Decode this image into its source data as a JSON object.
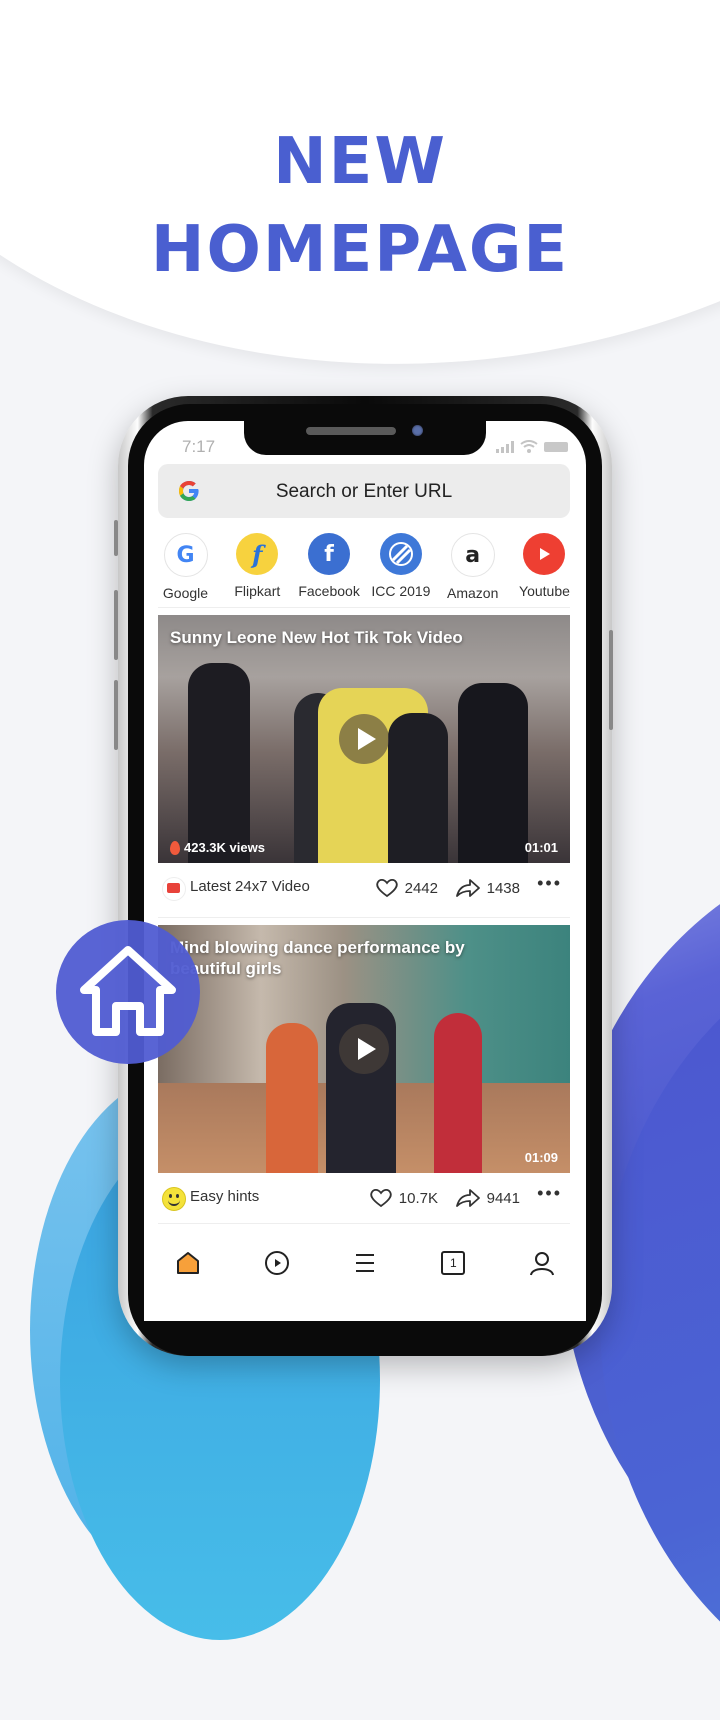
{
  "headline": {
    "line1": "NEW",
    "line2": "HOMEPAGE",
    "color": "#4a5fd0"
  },
  "status_bar": {
    "time": "7:17"
  },
  "search": {
    "placeholder": "Search or Enter URL"
  },
  "shortcuts": [
    {
      "label": "Google",
      "icon": "google-icon"
    },
    {
      "label": "Flipkart",
      "icon": "flipkart-icon"
    },
    {
      "label": "Facebook",
      "icon": "facebook-icon"
    },
    {
      "label": "ICC 2019",
      "icon": "icc-icon"
    },
    {
      "label": "Amazon",
      "icon": "amazon-icon"
    },
    {
      "label": "Youtube",
      "icon": "youtube-icon"
    }
  ],
  "feed": [
    {
      "title": "Sunny Leone New Hot Tik Tok Video",
      "views": "423.3K views",
      "duration": "01:01",
      "source": "Latest 24x7 Video",
      "likes": "2442",
      "shares": "1438"
    },
    {
      "title": "Mind blowing dance performance by beautiful girls",
      "duration": "01:09",
      "source": "Easy hints",
      "likes": "10.7K",
      "shares": "9441"
    }
  ],
  "bottom_nav": [
    {
      "name": "home",
      "active": true,
      "accent": "#f7a03a"
    },
    {
      "name": "video"
    },
    {
      "name": "menu"
    },
    {
      "name": "tabs",
      "count": "1"
    },
    {
      "name": "profile"
    }
  ]
}
